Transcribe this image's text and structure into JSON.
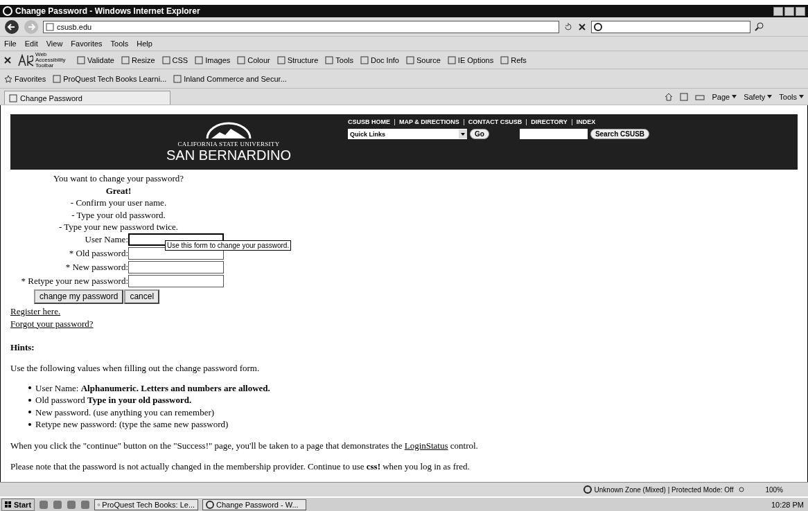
{
  "window": {
    "title": "Change Password - Windows Internet Explorer"
  },
  "address_bar": {
    "value": "csusb.edu"
  },
  "menu_bar": {
    "items": [
      "File",
      "Edit",
      "View",
      "Favorites",
      "Tools",
      "Help"
    ]
  },
  "accessibility_toolbar": {
    "name": "Web Accessibility Toolbar",
    "items": [
      "Validate",
      "Resize",
      "CSS",
      "Images",
      "Colour",
      "Structure",
      "Tools",
      "Doc Info",
      "Source",
      "IE Options",
      "Refs"
    ]
  },
  "favorites_bar": {
    "label": "Favorites",
    "items": [
      "ProQuest Tech Books Learni...",
      "Inland Commerce and Secur..."
    ]
  },
  "tab": {
    "title": "Change Password"
  },
  "command_bar": {
    "items": [
      "Page",
      "Safety",
      "Tools"
    ]
  },
  "site_header": {
    "logo_top": "CALIFORNIA STATE UNIVERSITY",
    "logo_bottom": "SAN BERNARDINO",
    "nav_links": [
      "CSUSB HOME",
      "MAP & DIRECTIONS",
      "CONTACT CSUSB",
      "DIRECTORY",
      "INDEX"
    ],
    "quick_links": {
      "value": "Quick Links"
    },
    "go_button": "Go",
    "search_button": "Search CSUSB"
  },
  "intro": {
    "question": "You want to change your password?",
    "exclaim": "Great!",
    "steps": [
      "- Confirm your user name.",
      "- Type your old password.",
      "- Type your new password twice."
    ]
  },
  "form": {
    "fields": [
      {
        "label": "User Name:",
        "focused": true
      },
      {
        "label": "* Old password:",
        "focused": false
      },
      {
        "label": "* New password:",
        "focused": false
      },
      {
        "label": "* Retype your new password:",
        "focused": false
      }
    ],
    "tooltip": "Use this form to change your password.",
    "buttons": [
      "change my password",
      "cancel"
    ]
  },
  "links": [
    "Register here.",
    "Forgot your password?"
  ],
  "hints": {
    "heading": "Hints:",
    "intro": "Use the following values when filling out the change password form.",
    "items": [
      "User Name: **Alphanumeric. Letters and numbers are allowed.**",
      "Old password **Type in your old password.**",
      "New password. (use anything you can remember)",
      "Retype new password: (type the same new password)"
    ],
    "note_before": "When you click the \"continue\" button on the \"Success!\" page, you'll be taken to a page that demonstrates the ",
    "note_link": "LoginStatus",
    "note_after": " control.",
    "note2": "Please note that the password is not actually changed in the membership provider. Continue to use **css!** when you log in as fred."
  },
  "status_bar": {
    "zone": "Unknown Zone (Mixed) | Protected Mode: Off",
    "zoom": "100%"
  },
  "taskbar": {
    "start": "Start",
    "tasks": [
      "ProQuest Tech Books: Le...",
      "Change Password - W..."
    ],
    "clock": "10:28 PM"
  }
}
